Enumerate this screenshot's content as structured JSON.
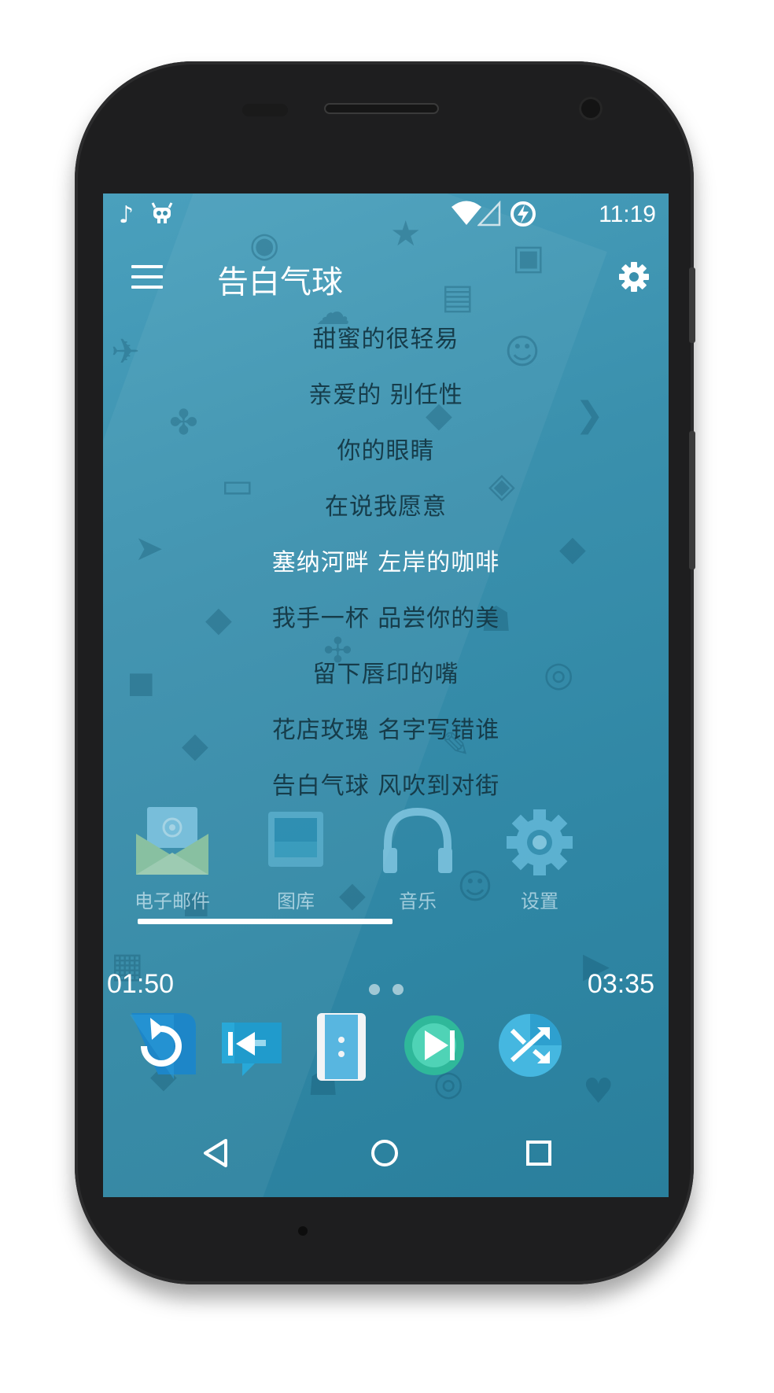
{
  "status_bar": {
    "time": "11:19",
    "left_icons": [
      "music-note-icon",
      "cyanogen-mascot-icon"
    ],
    "right_icons": [
      "wifi-icon",
      "cell-signal-icon",
      "battery-charging-icon"
    ]
  },
  "toolbar": {
    "title": "告白气球",
    "menu_icon": "hamburger-menu-icon",
    "settings_icon": "gear-icon"
  },
  "lyrics": [
    {
      "text": "甜蜜的很轻易",
      "current": false
    },
    {
      "text": "亲爱的 别任性",
      "current": false
    },
    {
      "text": "你的眼睛",
      "current": false
    },
    {
      "text": "在说我愿意",
      "current": false
    },
    {
      "text": "塞纳河畔 左岸的咖啡",
      "current": true
    },
    {
      "text": "我手一杯 品尝你的美",
      "current": false
    },
    {
      "text": "留下唇印的嘴",
      "current": false
    },
    {
      "text": "花店玫瑰 名字写错谁",
      "current": false
    },
    {
      "text": "告白气球 风吹到对街",
      "current": false
    }
  ],
  "dock_apps": [
    {
      "label": "电子邮件",
      "icon": "email-icon"
    },
    {
      "label": "图库",
      "icon": "gallery-icon"
    },
    {
      "label": "音乐",
      "icon": "headphones-icon"
    },
    {
      "label": "设置",
      "icon": "settings-gear-icon"
    }
  ],
  "player": {
    "elapsed": "01:50",
    "duration": "03:35",
    "progress_fraction": 0.51,
    "page_dots": 2,
    "controls": [
      "repeat-icon",
      "previous-icon",
      "pause-icon",
      "next-icon",
      "shuffle-icon"
    ]
  },
  "nav_bar": {
    "buttons": [
      "back-icon",
      "home-icon",
      "recents-icon"
    ]
  },
  "colors": {
    "accent": "#3a90ad",
    "lyric_text": "#163c4a",
    "lyric_current": "#ffffff"
  }
}
